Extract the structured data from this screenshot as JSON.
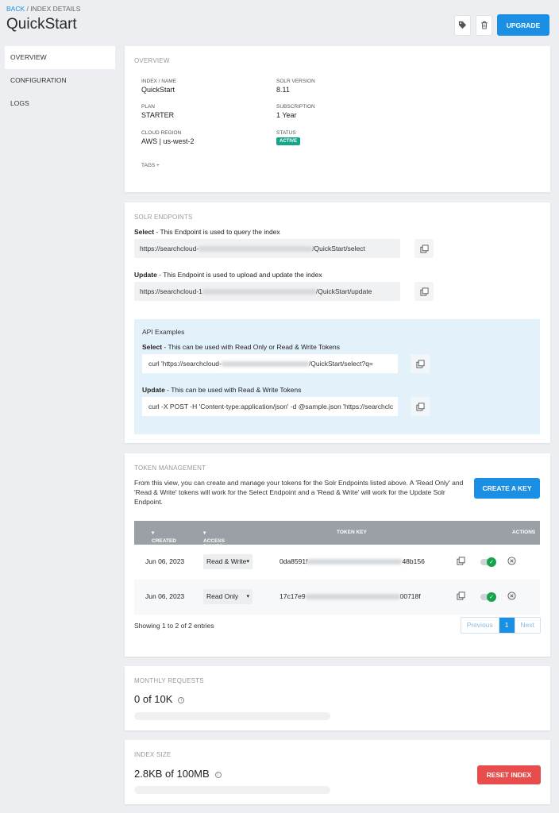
{
  "breadcrumb": {
    "back": "BACK",
    "current": "INDEX DETAILS"
  },
  "title": "QuickStart",
  "actions": {
    "upgrade": "UPGRADE"
  },
  "sidebar": {
    "items": [
      {
        "label": "OVERVIEW"
      },
      {
        "label": "CONFIGURATION"
      },
      {
        "label": "LOGS"
      }
    ]
  },
  "overview": {
    "title": "OVERVIEW",
    "fields": {
      "index_name": {
        "label": "INDEX / NAME",
        "value": "QuickStart"
      },
      "solr_version": {
        "label": "SOLR VERSION",
        "value": "8.11"
      },
      "plan": {
        "label": "PLAN",
        "value": "STARTER"
      },
      "subscription": {
        "label": "SUBSCRIPTION",
        "value": "1 Year"
      },
      "cloud_region": {
        "label": "CLOUD REGION",
        "value": "AWS | us-west-2"
      },
      "status": {
        "label": "STATUS",
        "value": "ACTIVE"
      }
    },
    "tags": "TAGS +"
  },
  "endpoints": {
    "title": "SOLR ENDPOINTS",
    "select": {
      "name": "Select",
      "desc": " - This Endpoint is used to query the index",
      "url_prefix": "https://searchcloud-",
      "url_suffix": "/QuickStart/select"
    },
    "update": {
      "name": "Update",
      "desc": " - This Endpoint is used to upload and update the index",
      "url_prefix": "https://searchcloud-1",
      "url_suffix": "/QuickStart/update"
    },
    "api": {
      "title": "API Examples",
      "select": {
        "name": "Select",
        "desc": " - This can be used with Read Only or Read & Write Tokens",
        "cmd_prefix": "curl 'https://searchcloud-",
        "cmd_suffix": "/QuickStart/select?q="
      },
      "update": {
        "name": "Update",
        "desc": " - This can be used with Read & Write Tokens",
        "cmd": "curl -X POST -H 'Content-type:application/json' -d @sample.json 'https://searchclc"
      }
    }
  },
  "tokens": {
    "title": "TOKEN MANAGEMENT",
    "description": "From this view, you can create and manage your tokens for the Solr Endpoints listed above. A 'Read Only' and 'Read & Write' tokens will work for the Select Endpoint and a 'Read & Write' will work for the Update Solr Endpoint.",
    "create_button": "CREATE A KEY",
    "columns": {
      "created": "CREATED",
      "access": "ACCESS RIGHTS",
      "key": "TOKEN KEY",
      "actions": "ACTIONS"
    },
    "rows": [
      {
        "created": "Jun 06, 2023",
        "access": "Read & Write",
        "key_prefix": "0da8591f",
        "key_suffix": "48b156",
        "enabled": true
      },
      {
        "created": "Jun 06, 2023",
        "access": "Read Only",
        "key_prefix": "17c17e9",
        "key_suffix": "00718f",
        "enabled": true
      }
    ],
    "entries": "Showing 1 to 2 of 2 entries",
    "pager": {
      "previous": "Previous",
      "current": "1",
      "next": "Next"
    }
  },
  "monthly_requests": {
    "title": "MONTHLY REQUESTS",
    "value": "0 of 10K",
    "progress": 0
  },
  "index_size": {
    "title": "INDEX SIZE",
    "value": "2.8KB of 100MB",
    "reset": "RESET INDEX",
    "progress": 0
  },
  "colors": {
    "accent": "#1a8fe3",
    "danger": "#e84c4c",
    "active": "#17a589",
    "toggle_on": "#17a34a"
  }
}
